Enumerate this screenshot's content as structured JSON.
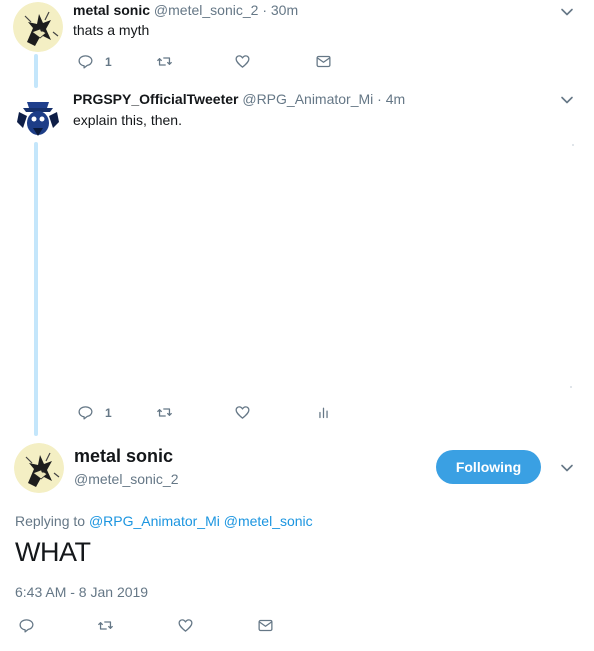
{
  "tweet1": {
    "name": "metal sonic",
    "handle": "@metel_sonic_2",
    "sep": "·",
    "time": "30m",
    "text": "thats a myth",
    "reply_count": "1"
  },
  "tweet2": {
    "name": "PRGSPY_OfficialTweeter",
    "handle": "@RPG_Animator_Mi",
    "sep": "·",
    "time": "4m",
    "text": "explain this, then.",
    "reply_count": "1"
  },
  "focus": {
    "name": "metal sonic",
    "handle": "@metel_sonic_2",
    "follow_label": "Following",
    "replying_prefix": "Replying to",
    "replying_users": [
      "@RPG_Animator_Mi",
      "@metel_sonic"
    ],
    "text": "WHAT",
    "timestamp": "6:43 AM - 8 Jan 2019"
  },
  "colors": {
    "accent": "#1b95e0",
    "follow_button": "#3aa0e3",
    "thread_line": "#c4e6fb",
    "muted": "#657786"
  },
  "icons": [
    "reply-icon",
    "retweet-icon",
    "like-icon",
    "direct-message-icon",
    "analytics-icon",
    "chevron-down-icon"
  ]
}
